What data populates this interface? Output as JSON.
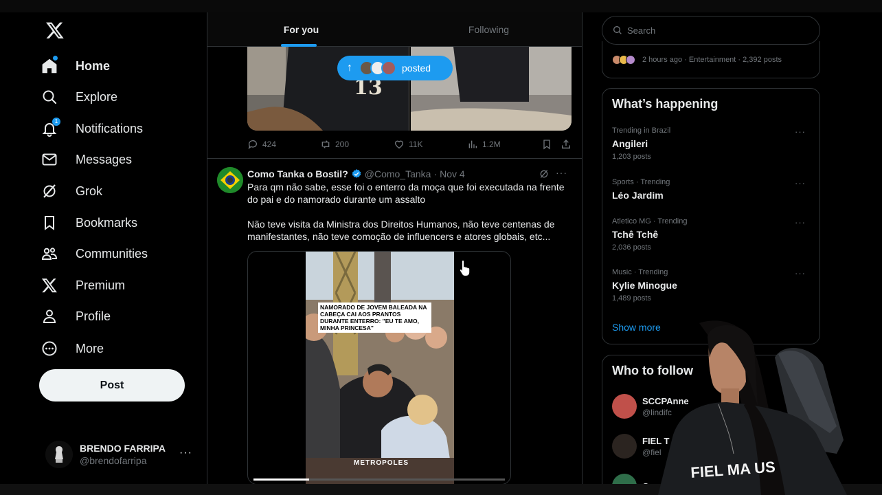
{
  "nav": {
    "items": [
      {
        "label": "Home",
        "icon": "home-icon"
      },
      {
        "label": "Explore",
        "icon": "search-icon"
      },
      {
        "label": "Notifications",
        "icon": "bell-icon",
        "badge": "1"
      },
      {
        "label": "Messages",
        "icon": "envelope-icon"
      },
      {
        "label": "Grok",
        "icon": "grok-icon"
      },
      {
        "label": "Bookmarks",
        "icon": "bookmark-icon"
      },
      {
        "label": "Communities",
        "icon": "communities-icon"
      },
      {
        "label": "Premium",
        "icon": "x-logo-icon"
      },
      {
        "label": "Profile",
        "icon": "person-icon"
      },
      {
        "label": "More",
        "icon": "more-circle-icon"
      }
    ],
    "post_label": "Post",
    "account": {
      "name": "BRENDO FARRIPA",
      "handle": "@brendofarripa",
      "more": "···"
    }
  },
  "timeline": {
    "tabs": [
      {
        "label": "For you",
        "active": true
      },
      {
        "label": "Following",
        "active": false
      }
    ],
    "posted_pill": {
      "arrow": "↑",
      "label": "posted"
    },
    "prev_tweet": {
      "jersey_number": "13",
      "replies": "424",
      "reposts": "200",
      "likes": "11K",
      "views": "1.2M"
    },
    "tweet": {
      "name": "Como Tanka o Bostil?",
      "handle": "@Como_Tanka",
      "sep": "·",
      "date": "Nov 4",
      "more": "···",
      "body": [
        "Para qm não sabe, esse foi o enterro da moça que foi executada na frente do pai e do namorado durante um assalto",
        "Não teve visita da Ministra dos Direitos Humanos, não teve centenas de manifestantes, não teve comoção de influencers e atores globais, etc..."
      ],
      "video": {
        "caption": "NAMORADO DE JOVEM BALEADA NA CABEÇA CAI AOS PRANTOS DURANTE ENTERRO: \"EU TE AMO, MINHA PRINCESA\"",
        "watermark": "METROPOLES",
        "progress": 0.22
      }
    }
  },
  "right": {
    "search_placeholder": "Search",
    "live": {
      "text": "2 hours ago · Entertainment · 2,392 posts"
    },
    "happening": {
      "title": "What’s happening",
      "trends": [
        {
          "context": "Trending in Brazil",
          "name": "Angileri",
          "count": "1,203 posts"
        },
        {
          "context": "Sports · Trending",
          "name": "Léo Jardim",
          "count": ""
        },
        {
          "context": "Atletico MG · Trending",
          "name": "Tchê Tchê",
          "count": "2,036 posts"
        },
        {
          "context": "Music · Trending",
          "name": "Kylie Minogue",
          "count": "1,489 posts"
        }
      ],
      "more": "···",
      "show_more": "Show more"
    },
    "who_to_follow": {
      "title": "Who to follow",
      "accounts": [
        {
          "name": "SCCPAnne",
          "handle": "@lindifc"
        },
        {
          "name": "FIEL T",
          "handle": "@fiel"
        },
        {
          "name": "C",
          "handle": ""
        }
      ]
    }
  },
  "webcam": {
    "shirt_text": "FIEL MA US"
  },
  "colors": {
    "accent": "#1d9bf0",
    "background": "#000000",
    "border": "#2f3336",
    "muted": "#71767b"
  }
}
